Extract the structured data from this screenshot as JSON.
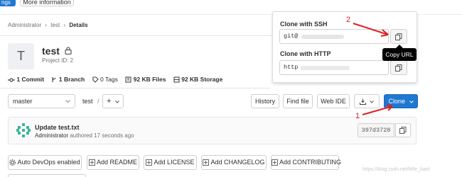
{
  "top_tabs": {
    "settings_partial": "ngs",
    "more_info": "More information"
  },
  "breadcrumb": {
    "item1": "Administrator",
    "sep": "›",
    "item2": "test",
    "item3": "Details"
  },
  "project": {
    "avatar_letter": "T",
    "name": "test",
    "id_label": "Project ID: 2"
  },
  "stats": {
    "commits": "1 Commit",
    "branches": "1 Branch",
    "tags": "0 Tags",
    "files": "92 KB Files",
    "storage": "92 KB Storage"
  },
  "repo_bar": {
    "branch": "master",
    "path": "test",
    "path_sep": "/",
    "history": "History",
    "find_file": "Find file",
    "web_ide": "Web IDE",
    "clone": "Clone"
  },
  "commit": {
    "title": "Update test.txt",
    "author": "Administrator",
    "meta": "authored 17 seconds ago",
    "sha": "397d3728"
  },
  "quick_actions": [
    "Auto DevOps enabled",
    "Add README",
    "Add LICENSE",
    "Add CHANGELOG",
    "Add CONTRIBUTING"
  ],
  "clone_panel": {
    "ssh_title": "Clone with SSH",
    "ssh_value": "git@",
    "http_title": "Clone with HTTP",
    "http_value": "http",
    "tooltip": "Copy URL"
  },
  "annotations": {
    "one": "1",
    "two": "2"
  },
  "watermark": "https://blog.csdn.net/little_baid"
}
